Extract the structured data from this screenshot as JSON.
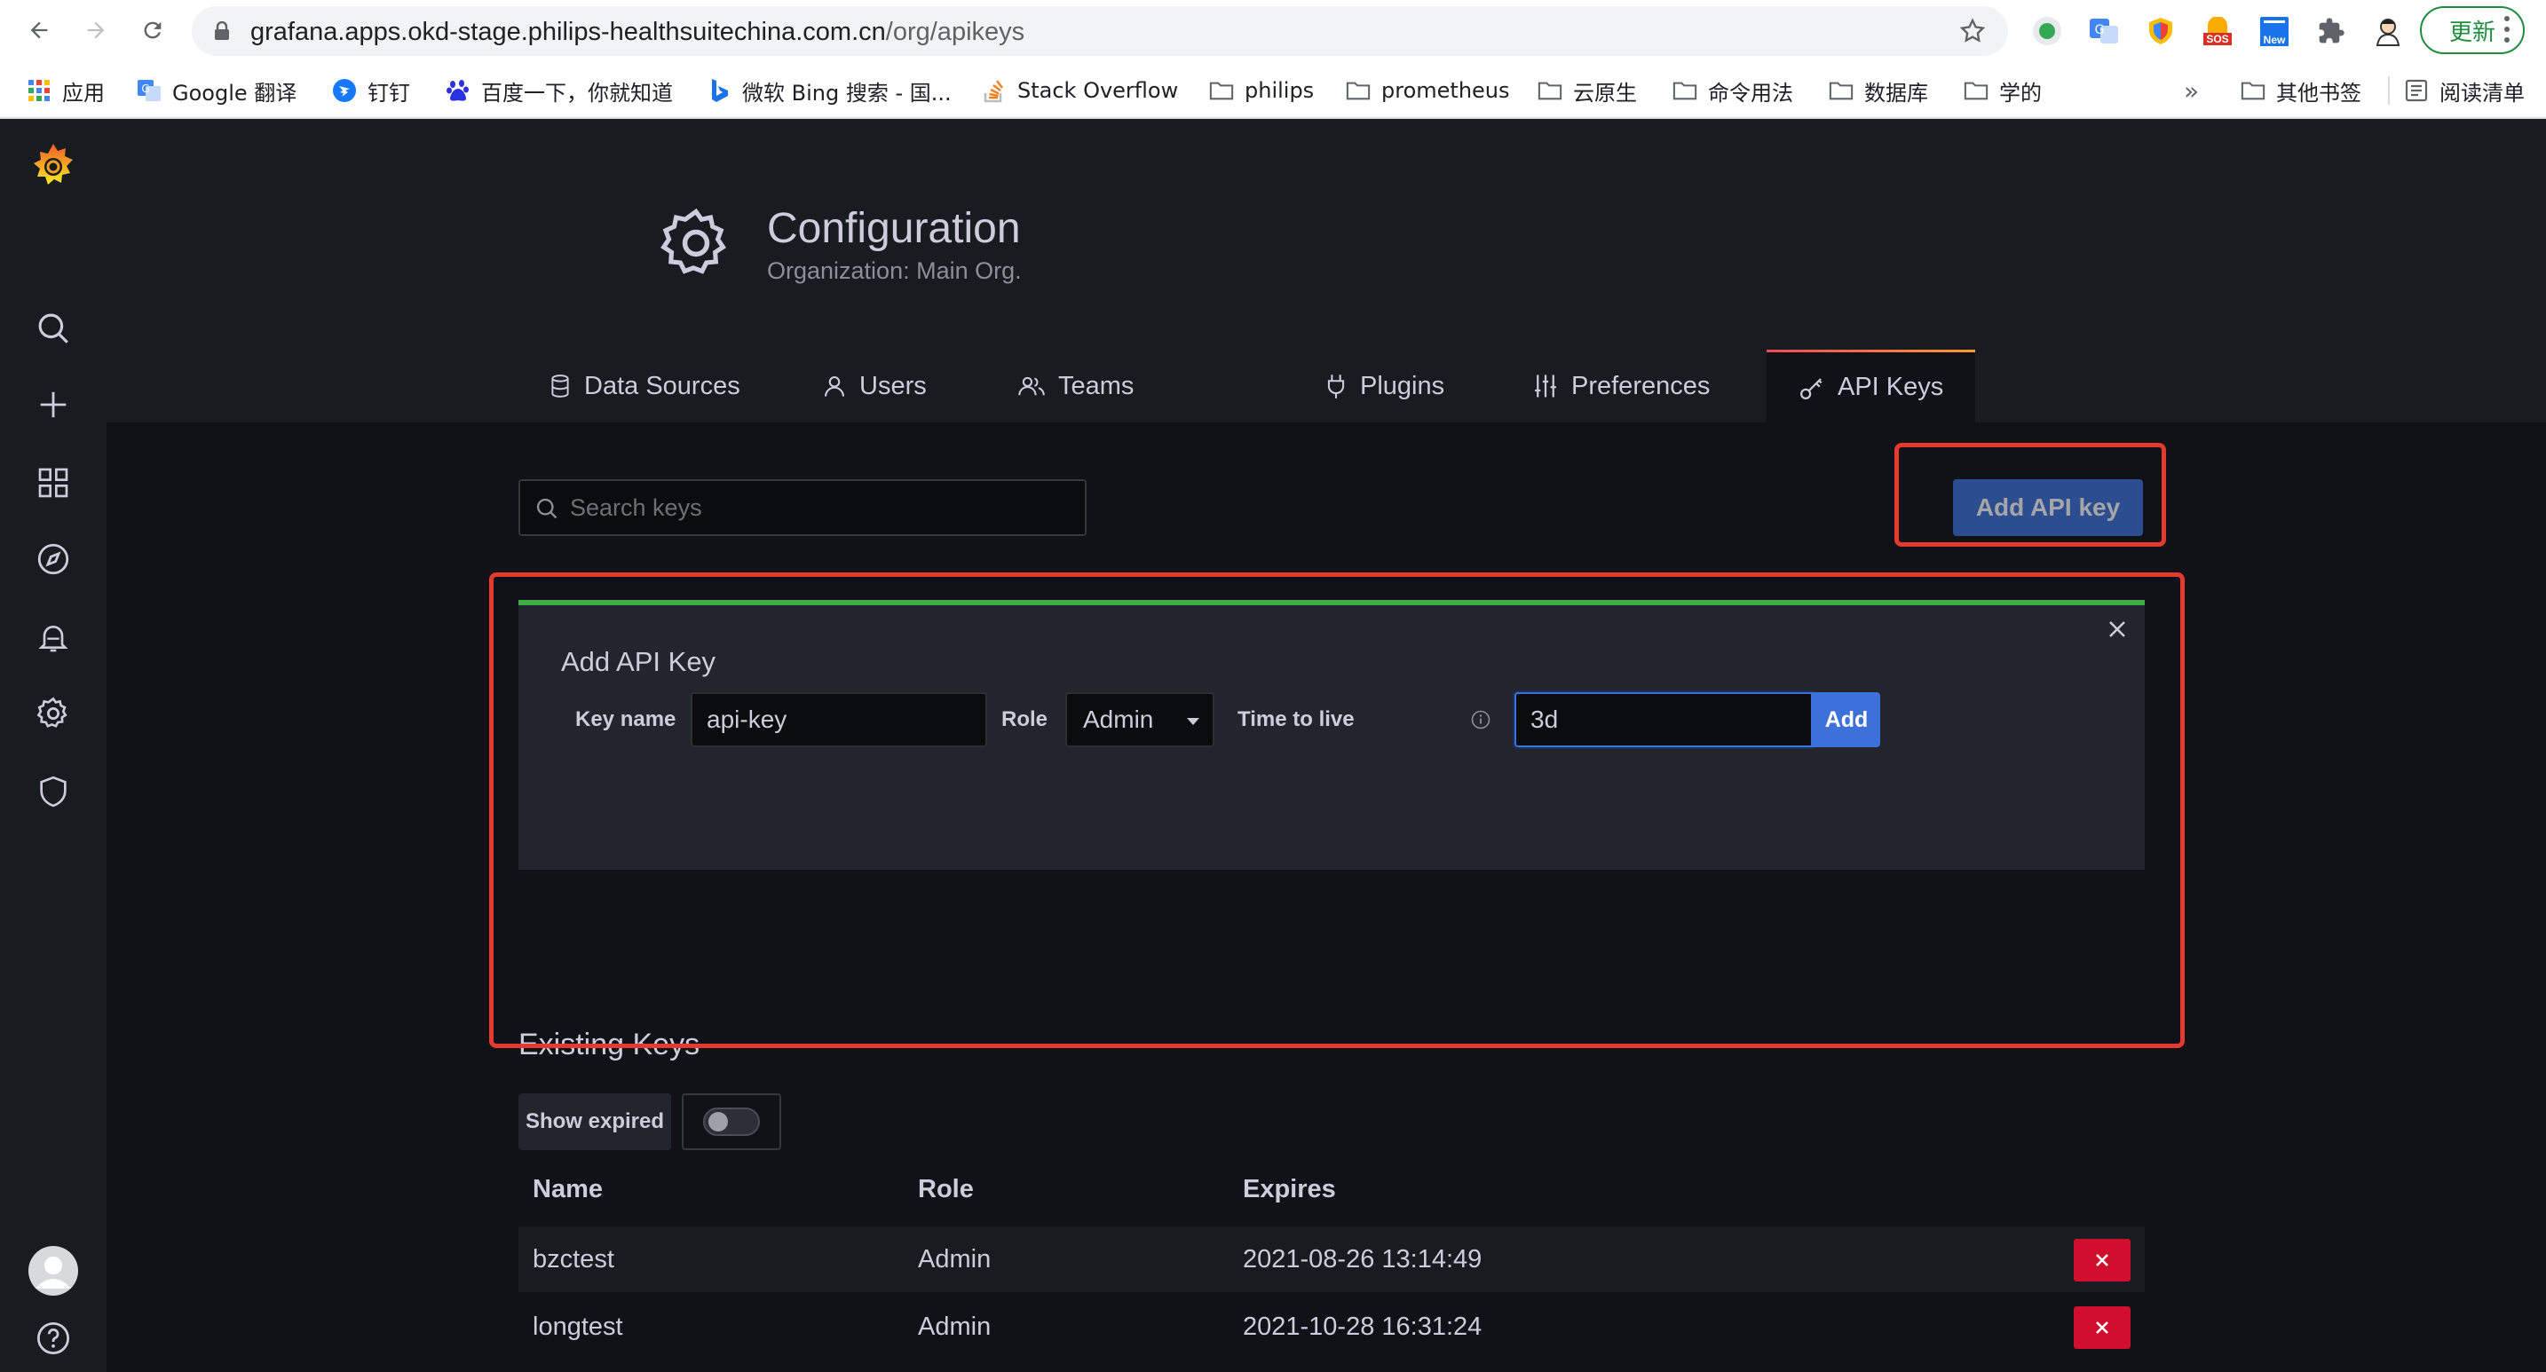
{
  "browser": {
    "url_host": "grafana.apps.okd-stage.philips-healthsuitechina.com.cn",
    "url_path": "/org/apikeys",
    "update_label": "更新",
    "bookmarks": [
      {
        "label": "应用",
        "icon": "apps-grid-icon"
      },
      {
        "label": "Google 翻译",
        "icon": "google-translate-icon"
      },
      {
        "label": "钉钉",
        "icon": "dingtalk-icon"
      },
      {
        "label": "百度一下，你就知道",
        "icon": "baidu-paw-icon"
      },
      {
        "label": "微软 Bing 搜索 - 国...",
        "icon": "bing-icon"
      },
      {
        "label": "Stack Overflow",
        "icon": "stackoverflow-icon"
      },
      {
        "label": "philips",
        "icon": "folder-icon"
      },
      {
        "label": "prometheus",
        "icon": "folder-icon"
      },
      {
        "label": "云原生",
        "icon": "folder-icon"
      },
      {
        "label": "命令用法",
        "icon": "folder-icon"
      },
      {
        "label": "数据库",
        "icon": "folder-icon"
      },
      {
        "label": "学的",
        "icon": "folder-icon"
      }
    ],
    "overflow_label": "»",
    "other_bookmarks": "其他书签",
    "reading_list": "阅读清单",
    "ext_badges": {
      "sos": "SOS",
      "new": "New"
    }
  },
  "header": {
    "title": "Configuration",
    "subtitle": "Organization: Main Org."
  },
  "tabs": [
    {
      "label": "Data Sources",
      "icon": "database-icon"
    },
    {
      "label": "Users",
      "icon": "user-icon"
    },
    {
      "label": "Teams",
      "icon": "users-icon"
    },
    {
      "label": "Plugins",
      "icon": "plug-icon"
    },
    {
      "label": "Preferences",
      "icon": "sliders-icon"
    },
    {
      "label": "API Keys",
      "icon": "key-icon",
      "active": true
    }
  ],
  "search": {
    "placeholder": "Search keys",
    "value": ""
  },
  "add_api_key_button": "Add API key",
  "add_form": {
    "title": "Add API Key",
    "key_name_label": "Key name",
    "key_name_value": "api-key",
    "role_label": "Role",
    "role_value": "Admin",
    "ttl_label": "Time to live",
    "ttl_value": "3d",
    "add_button": "Add"
  },
  "existing": {
    "title": "Existing Keys",
    "show_expired_label": "Show expired",
    "show_expired": false,
    "columns": [
      "Name",
      "Role",
      "Expires"
    ],
    "rows": [
      {
        "name": "bzctest",
        "role": "Admin",
        "expires": "2021-08-26 13:14:49"
      },
      {
        "name": "longtest",
        "role": "Admin",
        "expires": "2021-10-28 16:31:24"
      }
    ]
  },
  "colors": {
    "accent_blue": "#3d71d9",
    "success_green": "#3fac49",
    "danger_red": "#d10e2e",
    "highlight_red": "#e53a2f"
  }
}
